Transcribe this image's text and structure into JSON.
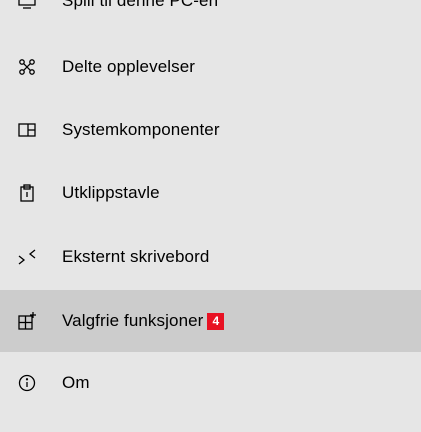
{
  "nav": {
    "items": [
      {
        "label": "Spill til denne PC-en",
        "icon": "project-to-pc-icon"
      },
      {
        "label": "Delte opplevelser",
        "icon": "shared-experiences-icon"
      },
      {
        "label": "Systemkomponenter",
        "icon": "system-components-icon"
      },
      {
        "label": "Utklippstavle",
        "icon": "clipboard-icon"
      },
      {
        "label": "Eksternt skrivebord",
        "icon": "remote-desktop-icon"
      },
      {
        "label": "Valgfrie funksjoner",
        "icon": "optional-features-icon",
        "badge": "4",
        "selected": true
      },
      {
        "label": "Om",
        "icon": "info-icon"
      }
    ]
  },
  "colors": {
    "background": "#e6e6e6",
    "selected": "#cccccc",
    "badge": "#e81123"
  }
}
